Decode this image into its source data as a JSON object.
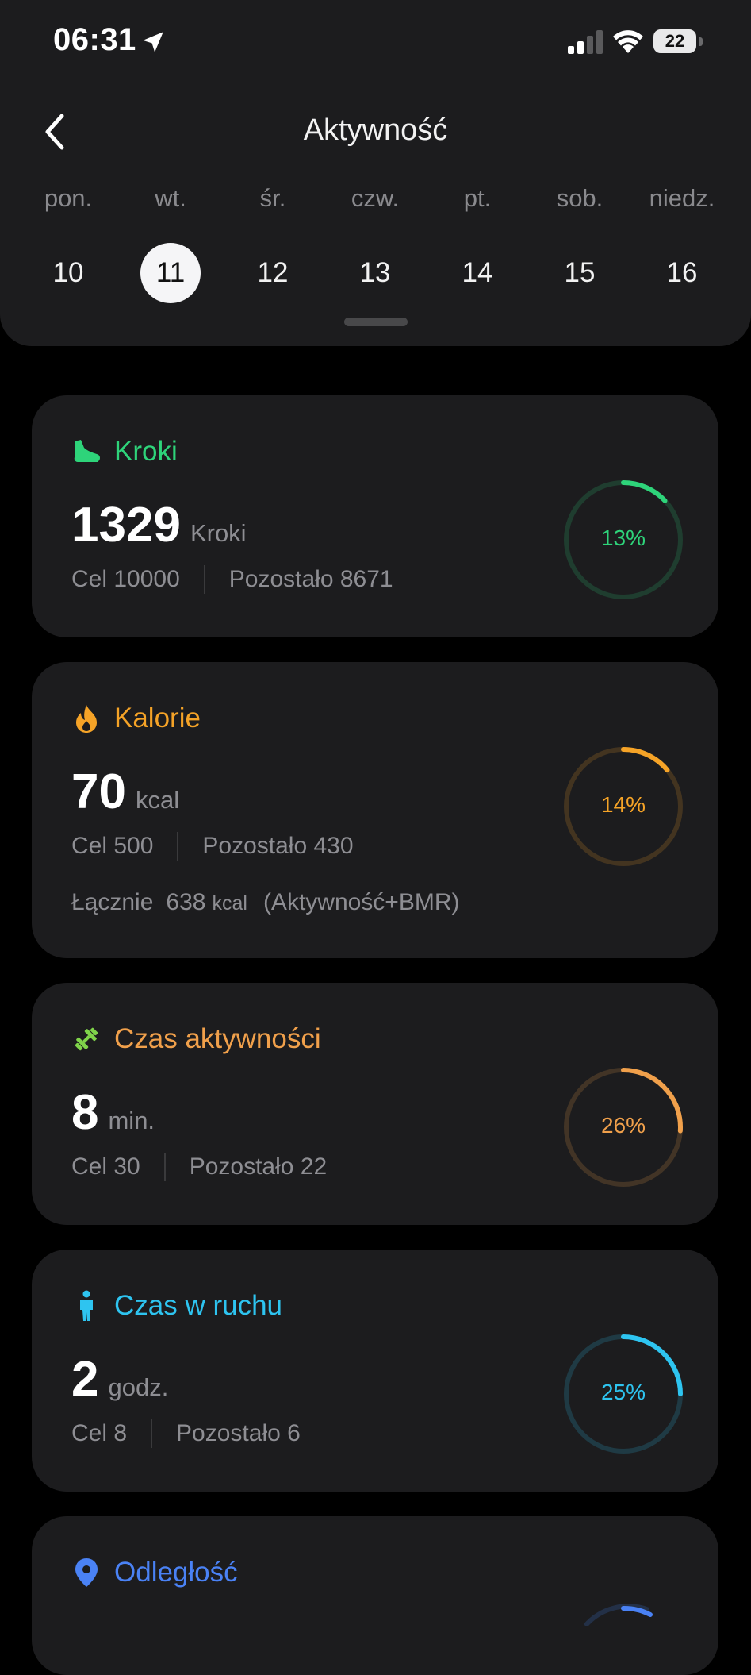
{
  "status_bar": {
    "time": "06:31",
    "battery": "22"
  },
  "header": {
    "title": "Aktywność"
  },
  "week": [
    {
      "name": "pon.",
      "num": "10",
      "selected": false
    },
    {
      "name": "wt.",
      "num": "11",
      "selected": true
    },
    {
      "name": "śr.",
      "num": "12",
      "selected": false
    },
    {
      "name": "czw.",
      "num": "13",
      "selected": false
    },
    {
      "name": "pt.",
      "num": "14",
      "selected": false
    },
    {
      "name": "sob.",
      "num": "15",
      "selected": false
    },
    {
      "name": "niedz.",
      "num": "16",
      "selected": false
    }
  ],
  "colors": {
    "steps": "#2ed47a",
    "calories": "#f5a327",
    "active_time": "#f0a04b",
    "active_time_icon": "#7fd34a",
    "moving": "#2ec4f0",
    "distance": "#4a82f5"
  },
  "cards": {
    "steps": {
      "icon": "shoe-icon",
      "title": "Kroki",
      "value": "1329",
      "unit": "Kroki",
      "goal": "Cel 10000",
      "remaining": "Pozostało 8671",
      "percent_label": "13%",
      "progress": 0.13
    },
    "calories": {
      "icon": "flame-icon",
      "title": "Kalorie",
      "value": "70",
      "unit": "kcal",
      "goal": "Cel 500",
      "remaining": "Pozostało 430",
      "total_label": "Łącznie",
      "total_value": "638",
      "total_unit": "kcal",
      "total_note": "(Aktywność+BMR)",
      "percent_label": "14%",
      "progress": 0.14
    },
    "active_time": {
      "icon": "dumbbell-icon",
      "title": "Czas aktywności",
      "value": "8",
      "unit": "min.",
      "goal": "Cel 30",
      "remaining": "Pozostało 22",
      "percent_label": "26%",
      "progress": 0.26
    },
    "moving": {
      "icon": "person-icon",
      "title": "Czas w ruchu",
      "value": "2",
      "unit": "godz.",
      "goal": "Cel 8",
      "remaining": "Pozostało 6",
      "percent_label": "25%",
      "progress": 0.25
    },
    "distance": {
      "icon": "location-pin-icon",
      "title": "Odległość"
    }
  }
}
